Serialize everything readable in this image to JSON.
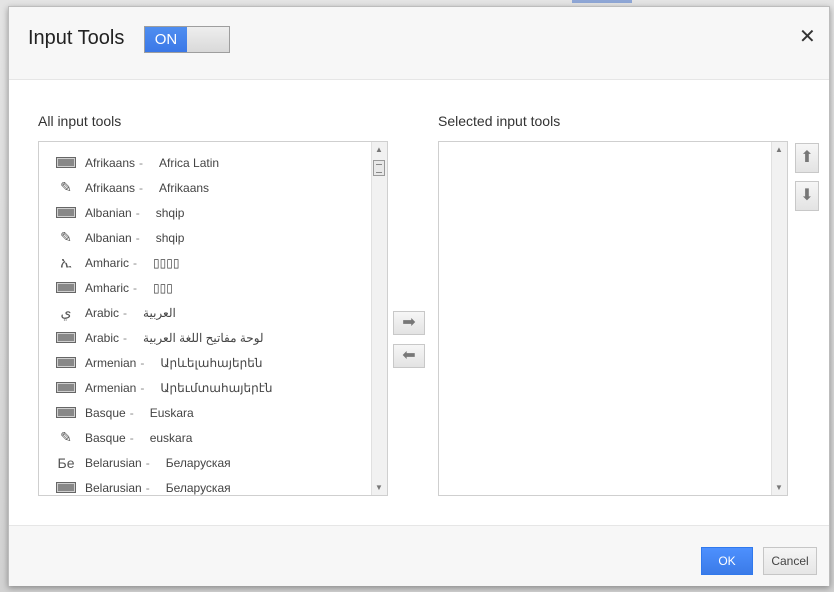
{
  "dialog": {
    "title": "Input Tools",
    "toggle_label": "ON",
    "close_symbol": "✕"
  },
  "all_tools": {
    "label": "All input tools",
    "items": [
      {
        "icon": "keyboard-icon",
        "language": "Afrikaans",
        "native": "Africa Latin"
      },
      {
        "icon": "pencil-icon",
        "language": "Afrikaans",
        "native": "Afrikaans"
      },
      {
        "icon": "keyboard-icon",
        "language": "Albanian",
        "native": "shqip"
      },
      {
        "icon": "pencil-icon",
        "language": "Albanian",
        "native": "shqip"
      },
      {
        "icon": "ethiopic-glyph-icon",
        "language": "Amharic",
        "native": "▯▯▯▯"
      },
      {
        "icon": "keyboard-icon",
        "language": "Amharic",
        "native": "▯▯▯"
      },
      {
        "icon": "arabic-glyph-icon",
        "language": "Arabic",
        "native": "العربية"
      },
      {
        "icon": "keyboard-icon",
        "language": "Arabic",
        "native": "لوحة مفاتيح اللغة العربية"
      },
      {
        "icon": "keyboard-icon",
        "language": "Armenian",
        "native": "Արևելահայերեն"
      },
      {
        "icon": "keyboard-icon",
        "language": "Armenian",
        "native": "Արեւմտահայերէն"
      },
      {
        "icon": "keyboard-icon",
        "language": "Basque",
        "native": "Euskara"
      },
      {
        "icon": "pencil-icon",
        "language": "Basque",
        "native": "euskara"
      },
      {
        "icon": "cyrillic-glyph-icon",
        "language": "Belarusian",
        "native": "Беларуская"
      },
      {
        "icon": "keyboard-icon",
        "language": "Belarusian",
        "native": "Беларуская"
      }
    ]
  },
  "selected_tools": {
    "label": "Selected input tools",
    "items": []
  },
  "icons": {
    "ethiopic_glyph": "ኢ",
    "arabic_glyph": "ي",
    "cyrillic_glyph": "Бе",
    "pencil_glyph": "✎",
    "add_arrow": "➡",
    "remove_arrow": "⬅",
    "up_arrow": "⬆",
    "down_arrow": "⬇"
  },
  "footer": {
    "ok_label": "OK",
    "cancel_label": "Cancel"
  },
  "colors": {
    "accent": "#3b78e7",
    "ok_button": "#4d90fe"
  }
}
